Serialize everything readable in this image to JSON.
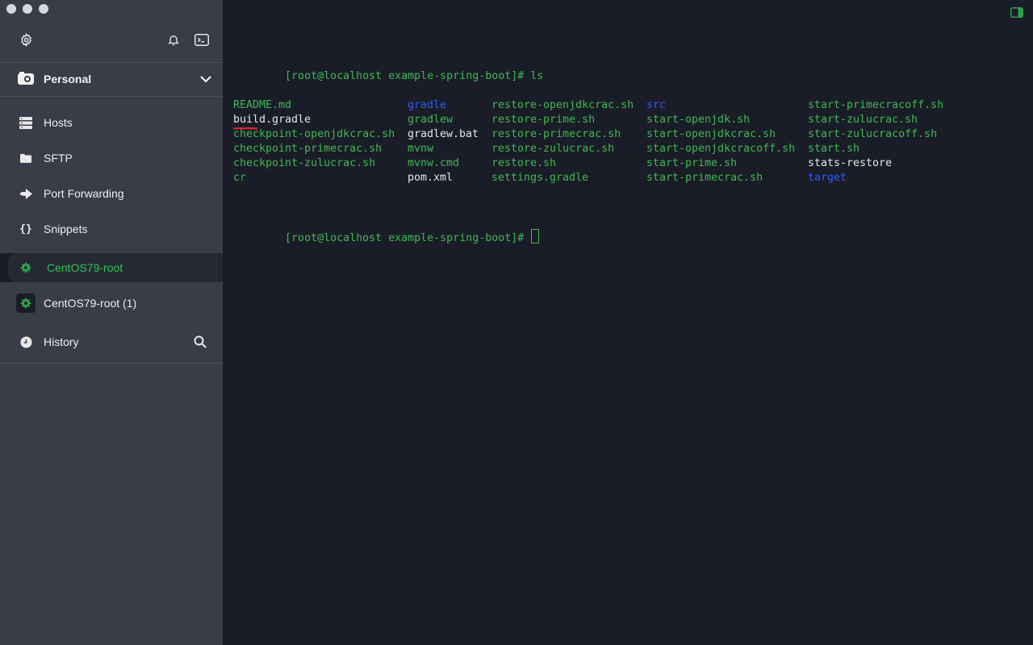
{
  "sidebar": {
    "vault": {
      "label": "Personal"
    },
    "nav": [
      {
        "label": "Hosts",
        "icon": "hosts-icon"
      },
      {
        "label": "SFTP",
        "icon": "folder-icon"
      },
      {
        "label": "Port Forwarding",
        "icon": "port-forwarding-icon"
      },
      {
        "label": "Snippets",
        "icon": "snippets-icon"
      }
    ],
    "sessions": [
      {
        "label": "CentOS79-root",
        "active": true
      },
      {
        "label": "CentOS79-root (1)",
        "active": false
      }
    ],
    "history": {
      "label": "History"
    }
  },
  "terminal": {
    "lines": [
      {
        "prompt": "[root@localhost example-spring-boot]# ",
        "command": "ls"
      },
      {
        "prompt": "[root@localhost example-spring-boot]# ",
        "command": ""
      }
    ],
    "ls_columns": [
      [
        "README.md",
        "build.gradle",
        "checkpoint-openjdkcrac.sh",
        "checkpoint-primecrac.sh",
        "checkpoint-zulucrac.sh",
        "cr"
      ],
      [
        "gradle",
        "gradlew",
        "gradlew.bat",
        "mvnw",
        "mvnw.cmd",
        "pom.xml"
      ],
      [
        "restore-openjdkcrac.sh",
        "restore-prime.sh",
        "restore-primecrac.sh",
        "restore-zulucrac.sh",
        "restore.sh",
        "settings.gradle"
      ],
      [
        "src",
        "start-openjdk.sh",
        "start-openjdkcrac.sh",
        "start-openjdkcracoff.sh",
        "start-prime.sh",
        "start-primecrac.sh"
      ],
      [
        "start-primecracoff.sh",
        "start-zulucrac.sh",
        "start-zulucracoff.sh",
        "start.sh",
        "stats-restore",
        "target"
      ]
    ],
    "ls_colors": [
      [
        "green",
        "white",
        "green",
        "green",
        "green",
        "green"
      ],
      [
        "blue",
        "green",
        "white",
        "green",
        "green",
        "white"
      ],
      [
        "green",
        "green",
        "green",
        "green",
        "green",
        "green"
      ],
      [
        "blue",
        "green",
        "green",
        "green",
        "green",
        "green"
      ],
      [
        "green",
        "green",
        "green",
        "green",
        "white",
        "blue"
      ]
    ]
  },
  "colors": {
    "sidebar_bg": "#3a3d47",
    "terminal_bg": "#1a1c28",
    "accent_green": "#3fb950",
    "directory_blue": "#2f5cf5",
    "annotation_red": "#e0262a"
  }
}
